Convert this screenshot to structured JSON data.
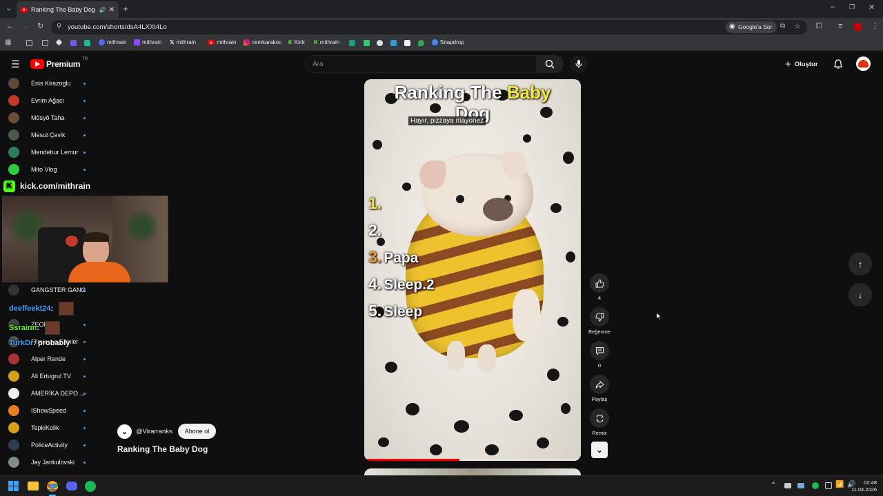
{
  "browser": {
    "tab_title": "Ranking The Baby Dog - Yo",
    "url": "youtube.com/shorts/dsA4LXXt4Lo",
    "google_lens": "Google'a Sor",
    "bookmarks": [
      "mithrain",
      "mithrain",
      "mithrain",
      "mithrain",
      "cemkarakoc",
      "Kick",
      "mithrain",
      "Snapdrop"
    ]
  },
  "youtube": {
    "brand": "Premium",
    "country": "TR",
    "search_placeholder": "Ara",
    "create_label": "Oluştur"
  },
  "sidebar": {
    "items": [
      {
        "label": "Enis Kirazoglu",
        "color": "#5a4a3a"
      },
      {
        "label": "Evrim Ağacı",
        "color": "#c0392b"
      },
      {
        "label": "Mösyö Taha",
        "color": "#6b4a3a"
      },
      {
        "label": "Mesut Çevik",
        "color": "#4a5a4a"
      },
      {
        "label": "Mendebur Lemur",
        "color": "#2e7d5b"
      },
      {
        "label": "Mito Vlog",
        "color": "#2ecc40"
      },
      {
        "label": "GANGSTER GANG",
        "color": "#333333"
      },
      {
        "label": "ZEON",
        "color": "#444444"
      },
      {
        "label": "Filmler ve Filmler",
        "color": "#555555"
      },
      {
        "label": "Alper Rende",
        "color": "#a33"
      },
      {
        "label": "Ali Ertugrul TV",
        "color": "#d4a017"
      },
      {
        "label": "AMERİKA DEPO ...",
        "color": "#eeeeee"
      },
      {
        "label": "IShowSpeed",
        "color": "#e67e22"
      },
      {
        "label": "TepkiKolik",
        "color": "#d4a017"
      },
      {
        "label": "PoliceActivity",
        "color": "#2c3e50"
      },
      {
        "label": "Jay Jankulovski",
        "color": "#7f8c8d"
      }
    ]
  },
  "overlay": {
    "kick_handle": "kick.com/mithrain",
    "chat": [
      {
        "user": "deeffeekt24",
        "msg": ":"
      },
      {
        "user": "Ssrainn",
        "msg": ":"
      },
      {
        "user": "TurkDr",
        "msg": ": probably"
      }
    ]
  },
  "video": {
    "title_part1": "Ranking The",
    "title_highlight": "Baby",
    "title_part2": "Dog",
    "subtitle": "Hayır, pizzaya mayonez",
    "ranks": [
      {
        "num": "1.",
        "label": "",
        "color": "#f5e642"
      },
      {
        "num": "2.",
        "label": "",
        "color": "#ffffff"
      },
      {
        "num": "3.",
        "label": "Papa",
        "color": "#f39c32"
      },
      {
        "num": "4.",
        "label": "Sleep.2",
        "color": "#ffffff"
      },
      {
        "num": "5.",
        "label": "Sleep",
        "color": "#ffffff"
      }
    ],
    "channel": "@Virarranks",
    "subscribe": "Abone ol",
    "short_title": "Ranking The Baby Dog",
    "progress": 0.44
  },
  "actions": {
    "likes": "4",
    "dislike": "Beğenme",
    "comments": "0",
    "share": "Paylaş",
    "remix": "Remix"
  },
  "taskbar": {
    "time": "02:48",
    "date": "11.04.2026"
  }
}
